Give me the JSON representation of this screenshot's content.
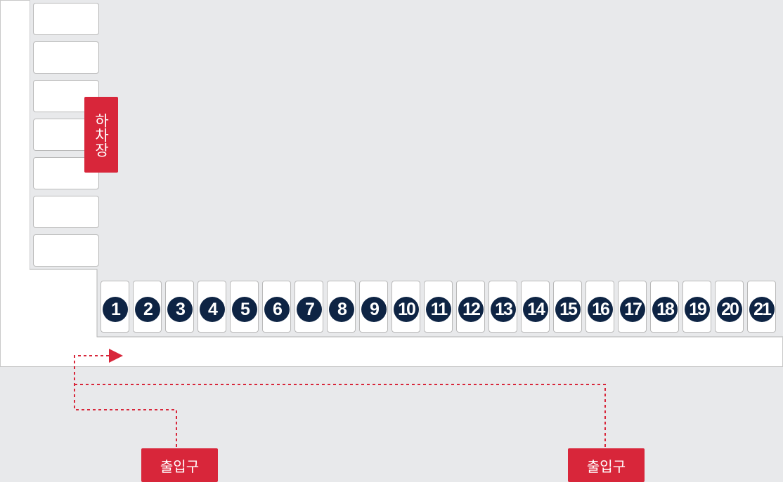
{
  "unloading_area": {
    "label": "하차장"
  },
  "left_bays": {
    "count": 7
  },
  "dock_doors": [
    "1",
    "2",
    "3",
    "4",
    "5",
    "6",
    "7",
    "8",
    "9",
    "10",
    "11",
    "12",
    "13",
    "14",
    "15",
    "16",
    "17",
    "18",
    "19",
    "20",
    "21"
  ],
  "exits": [
    {
      "label": "출입구"
    },
    {
      "label": "출입구"
    }
  ],
  "colors": {
    "accent_red": "#d8263a",
    "dock_number_navy": "#0e2444",
    "building_gray": "#e8e9eb",
    "route_dashed": "#d8263a"
  }
}
